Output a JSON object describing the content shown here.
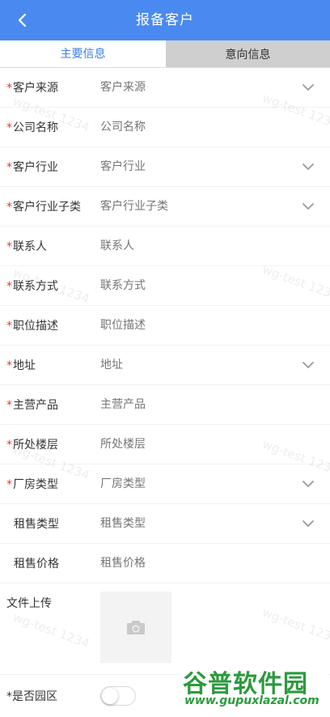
{
  "header": {
    "title": "报备客户",
    "back_icon": "chevron-left-icon"
  },
  "tabs": [
    {
      "label": "主要信息",
      "active": true
    },
    {
      "label": "意向信息",
      "active": false
    }
  ],
  "form": {
    "fields": [
      {
        "label": "客户来源",
        "placeholder": "客户来源",
        "required": true,
        "dropdown": true
      },
      {
        "label": "公司名称",
        "placeholder": "公司名称",
        "required": true,
        "dropdown": false
      },
      {
        "label": "客户行业",
        "placeholder": "客户行业",
        "required": true,
        "dropdown": true
      },
      {
        "label": "客户行业子类",
        "placeholder": "客户行业子类",
        "required": true,
        "dropdown": true
      },
      {
        "label": "联系人",
        "placeholder": "联系人",
        "required": true,
        "dropdown": false
      },
      {
        "label": "联系方式",
        "placeholder": "联系方式",
        "required": true,
        "dropdown": false
      },
      {
        "label": "职位描述",
        "placeholder": "职位描述",
        "required": true,
        "dropdown": false
      },
      {
        "label": "地址",
        "placeholder": "地址",
        "required": true,
        "dropdown": true
      },
      {
        "label": "主营产品",
        "placeholder": "主营产品",
        "required": true,
        "dropdown": false
      },
      {
        "label": "所处楼层",
        "placeholder": "所处楼层",
        "required": true,
        "dropdown": false
      },
      {
        "label": "厂房类型",
        "placeholder": "厂房类型",
        "required": true,
        "dropdown": true
      },
      {
        "label": "租售类型",
        "placeholder": "租售类型",
        "required": false,
        "dropdown": true
      },
      {
        "label": "租售价格",
        "placeholder": "租售价格",
        "required": false,
        "dropdown": false
      }
    ],
    "upload": {
      "label": "文件上传",
      "icon": "camera-icon"
    },
    "park": {
      "label": "是否园区",
      "required": true,
      "on": false
    }
  },
  "required_mark": "*",
  "watermark": "wg-test 1234",
  "logo": {
    "title": "谷普软件园",
    "url": "www.gupuxlazal.com"
  },
  "colors": {
    "primary": "#4a8af0",
    "required": "#ee3333",
    "placeholder": "#b9b9b9",
    "logo": "#2c9a3d"
  }
}
